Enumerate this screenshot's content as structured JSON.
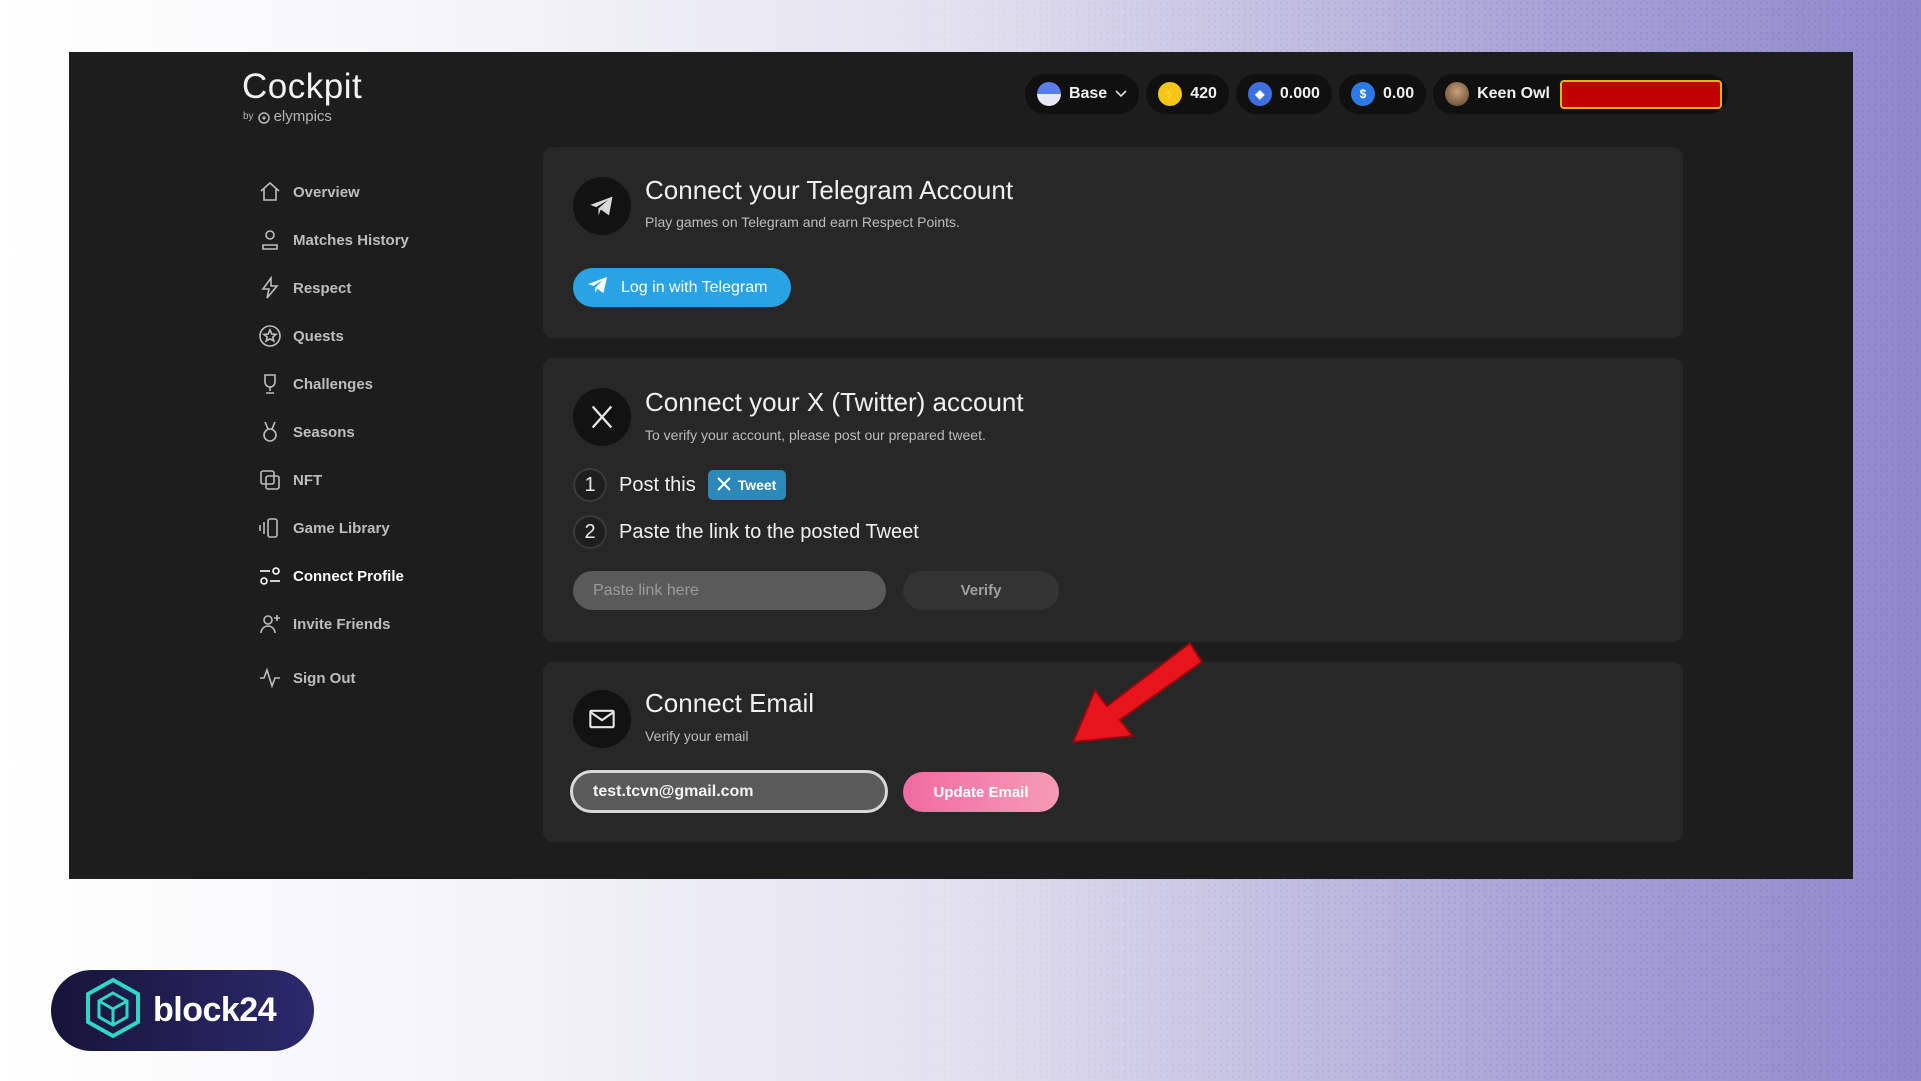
{
  "app": {
    "title": "Cockpit",
    "by_label": "by",
    "brand_name": "elympics"
  },
  "topbar": {
    "network": "Base",
    "points": "420",
    "eth_balance": "0.000",
    "usd_balance": "0.00",
    "username": "Keen Owl",
    "colors": {
      "points": "#f5c518",
      "eth": "#3d6fe0",
      "usd": "#2c7be5"
    }
  },
  "sidebar": {
    "items": [
      {
        "label": "Overview",
        "icon": "home-icon"
      },
      {
        "label": "Matches History",
        "icon": "person-icon"
      },
      {
        "label": "Respect",
        "icon": "lightning-icon"
      },
      {
        "label": "Quests",
        "icon": "star-badge-icon"
      },
      {
        "label": "Challenges",
        "icon": "trophy-icon"
      },
      {
        "label": "Seasons",
        "icon": "medal-icon"
      },
      {
        "label": "NFT",
        "icon": "copy-icon"
      },
      {
        "label": "Game Library",
        "icon": "library-icon"
      },
      {
        "label": "Connect Profile",
        "icon": "connect-icon",
        "active": true
      },
      {
        "label": "Invite Friends",
        "icon": "add-person-icon"
      },
      {
        "label": "Sign Out",
        "icon": "activity-icon"
      }
    ]
  },
  "telegram": {
    "title": "Connect your Telegram Account",
    "subtitle": "Play games on Telegram and earn Respect Points.",
    "button": "Log in with Telegram"
  },
  "twitter": {
    "title": "Connect your X (Twitter) account",
    "subtitle": "To verify your account, please post our prepared tweet.",
    "step1_num": "1",
    "step1_text": "Post this",
    "tweet_button": "Tweet",
    "step2_num": "2",
    "step2_text": "Paste the link to the posted Tweet",
    "input_placeholder": "Paste link here",
    "verify_button": "Verify"
  },
  "email": {
    "title": "Connect Email",
    "subtitle": "Verify your email",
    "value": "test.tcvn@gmail.com",
    "update_button": "Update Email"
  },
  "watermark": {
    "text": "block24"
  },
  "accent_colors": {
    "telegram": "#2aa3e6",
    "tweet": "#2a89b8",
    "update": "#f06ba0",
    "arrow": "#e8141b"
  }
}
